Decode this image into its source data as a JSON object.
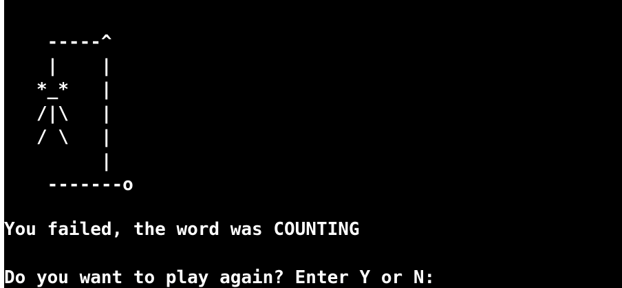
{
  "terminal": {
    "background": "#000000",
    "foreground": "#ffffff"
  },
  "gallows": {
    "lines": [
      "    -----^",
      "    |    |",
      "   *_*   |",
      "   /|\\   |",
      "   / \\   |",
      "         |",
      "    -------o"
    ]
  },
  "output": {
    "fail_message": "You failed, the word was COUNTING",
    "prompt": "Do you want to play again? Enter Y or N:"
  }
}
